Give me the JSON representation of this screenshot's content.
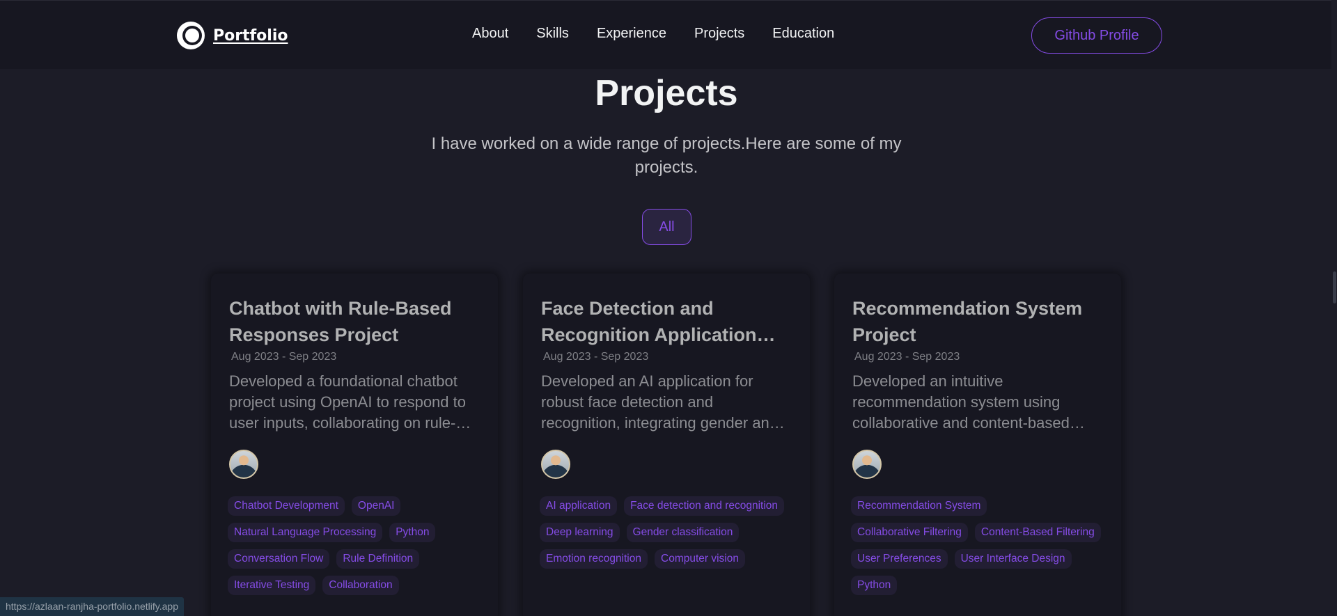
{
  "nav": {
    "logo_text": "Portfolio",
    "links": [
      "About",
      "Skills",
      "Experience",
      "Projects",
      "Education"
    ],
    "github_label": "Github Profile"
  },
  "section": {
    "title": "Projects",
    "description": "I have worked on a wide range of projects.Here are some of my projects.",
    "filter_label": "All"
  },
  "projects": [
    {
      "title": "Chatbot with Rule-Based Responses Project",
      "date": "Aug 2023 - Sep 2023",
      "description": "Developed a foundational chatbot project using OpenAI to respond to user inputs, collaborating on rule-based responses",
      "tags": [
        "Chatbot Development",
        "OpenAI",
        "Natural Language Processing",
        "Python",
        "Conversation Flow",
        "Rule Definition",
        "Iterative Testing",
        "Collaboration"
      ]
    },
    {
      "title": "Face Detection and Recognition Application Project",
      "date": "Aug 2023 - Sep 2023",
      "description": "Developed an AI application for robust face detection and recognition, integrating gender and emotion classification",
      "tags": [
        "AI application",
        "Face detection and recognition",
        "Deep learning",
        "Gender classification",
        "Emotion recognition",
        "Computer vision"
      ]
    },
    {
      "title": "Recommendation System Project",
      "date": "Aug 2023 - Sep 2023",
      "description": "Developed an intuitive recommendation system using collaborative and content-based filtering",
      "tags": [
        "Recommendation System",
        "Collaborative Filtering",
        "Content-Based Filtering",
        "User Preferences",
        "User Interface Design",
        "Python"
      ]
    }
  ],
  "status_url": "https://azlaan-ranjha-portfolio.netlify.app",
  "colors": {
    "accent": "#854ce6",
    "background": "#1c1c27",
    "card": "#171721"
  }
}
